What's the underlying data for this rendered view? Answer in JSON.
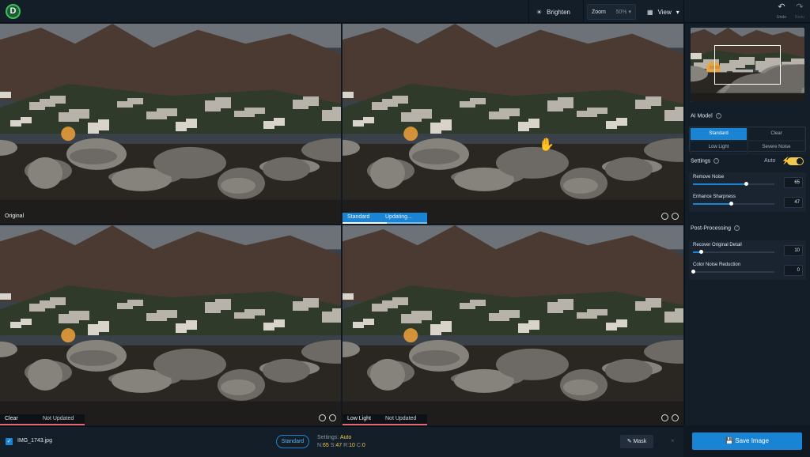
{
  "app": {
    "logo_letter": "D"
  },
  "toolbar": {
    "brighten_label": "Brighten",
    "zoom_label": "Zoom",
    "zoom_value": "50%",
    "view_label": "View",
    "undo_label": "Undo",
    "redo_label": "Redo"
  },
  "panes": [
    {
      "label": "Original"
    },
    {
      "model": "Standard",
      "status": "Updating...",
      "progress": 0.52
    },
    {
      "model": "Clear",
      "status": "Not Updated"
    },
    {
      "model": "Low Light",
      "status": "Not Updated"
    }
  ],
  "bottom": {
    "filename": "IMG_1743.jpg",
    "model_pill": "Standard",
    "settings_label": "Settings:",
    "settings_mode": "Auto",
    "n_label": "N:",
    "n_value": "65",
    "s_label": "S:",
    "s_value": "47",
    "r_label": "R:",
    "r_value": "10",
    "c_label": "C:",
    "c_value": "0",
    "mask_label": "Mask",
    "close_glyph": "×"
  },
  "panel": {
    "ai_model_title": "AI Model",
    "models": [
      "Standard",
      "Clear",
      "Low Light",
      "Severe Noise"
    ],
    "selected_model": "Standard",
    "settings_title": "Settings",
    "auto_label": "Auto",
    "auto_enabled": true,
    "sliders_main": [
      {
        "label": "Remove Noise",
        "value": "65",
        "fraction": 0.65
      },
      {
        "label": "Enhance Sharpness",
        "value": "47",
        "fraction": 0.47
      }
    ],
    "post_title": "Post-Processing",
    "sliders_post": [
      {
        "label": "Recover Original Detail",
        "value": "10",
        "fraction": 0.1
      },
      {
        "label": "Color Noise Reduction",
        "value": "0",
        "fraction": 0.0
      }
    ],
    "save_label": "Save Image"
  },
  "colors": {
    "accent": "#1a84d4",
    "warning": "#f2c94c",
    "not_updated": "#e56772"
  }
}
